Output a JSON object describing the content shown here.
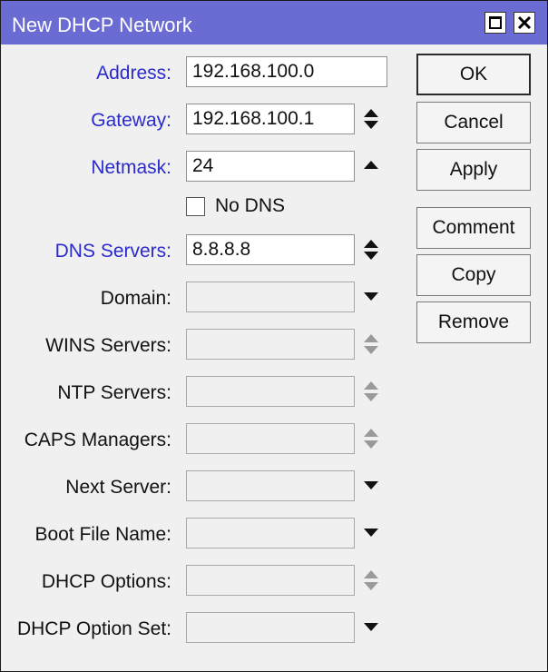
{
  "window": {
    "title": "New DHCP Network"
  },
  "form": {
    "address": {
      "label": "Address:",
      "value": "192.168.100.0"
    },
    "gateway": {
      "label": "Gateway:",
      "value": "192.168.100.1"
    },
    "netmask": {
      "label": "Netmask:",
      "value": "24"
    },
    "no_dns": {
      "label": "No DNS",
      "checked": false
    },
    "dns_servers": {
      "label": "DNS Servers:",
      "value": "8.8.8.8"
    },
    "domain": {
      "label": "Domain:",
      "value": ""
    },
    "wins_servers": {
      "label": "WINS Servers:",
      "value": ""
    },
    "ntp_servers": {
      "label": "NTP Servers:",
      "value": ""
    },
    "caps_managers": {
      "label": "CAPS Managers:",
      "value": ""
    },
    "next_server": {
      "label": "Next Server:",
      "value": ""
    },
    "boot_file_name": {
      "label": "Boot File Name:",
      "value": ""
    },
    "dhcp_options": {
      "label": "DHCP Options:",
      "value": ""
    },
    "dhcp_option_set": {
      "label": "DHCP Option Set:",
      "value": ""
    }
  },
  "buttons": {
    "ok": "OK",
    "cancel": "Cancel",
    "apply": "Apply",
    "comment": "Comment",
    "copy": "Copy",
    "remove": "Remove"
  },
  "colors": {
    "titlebar": "#6a6cd4",
    "active_label": "#2a2acf",
    "disabled_arrow": "#9a9a9a"
  },
  "icons": {
    "add_remove": "up-down-arrows-icon",
    "expand": "triangle-down-icon",
    "collapse": "triangle-up-icon"
  }
}
